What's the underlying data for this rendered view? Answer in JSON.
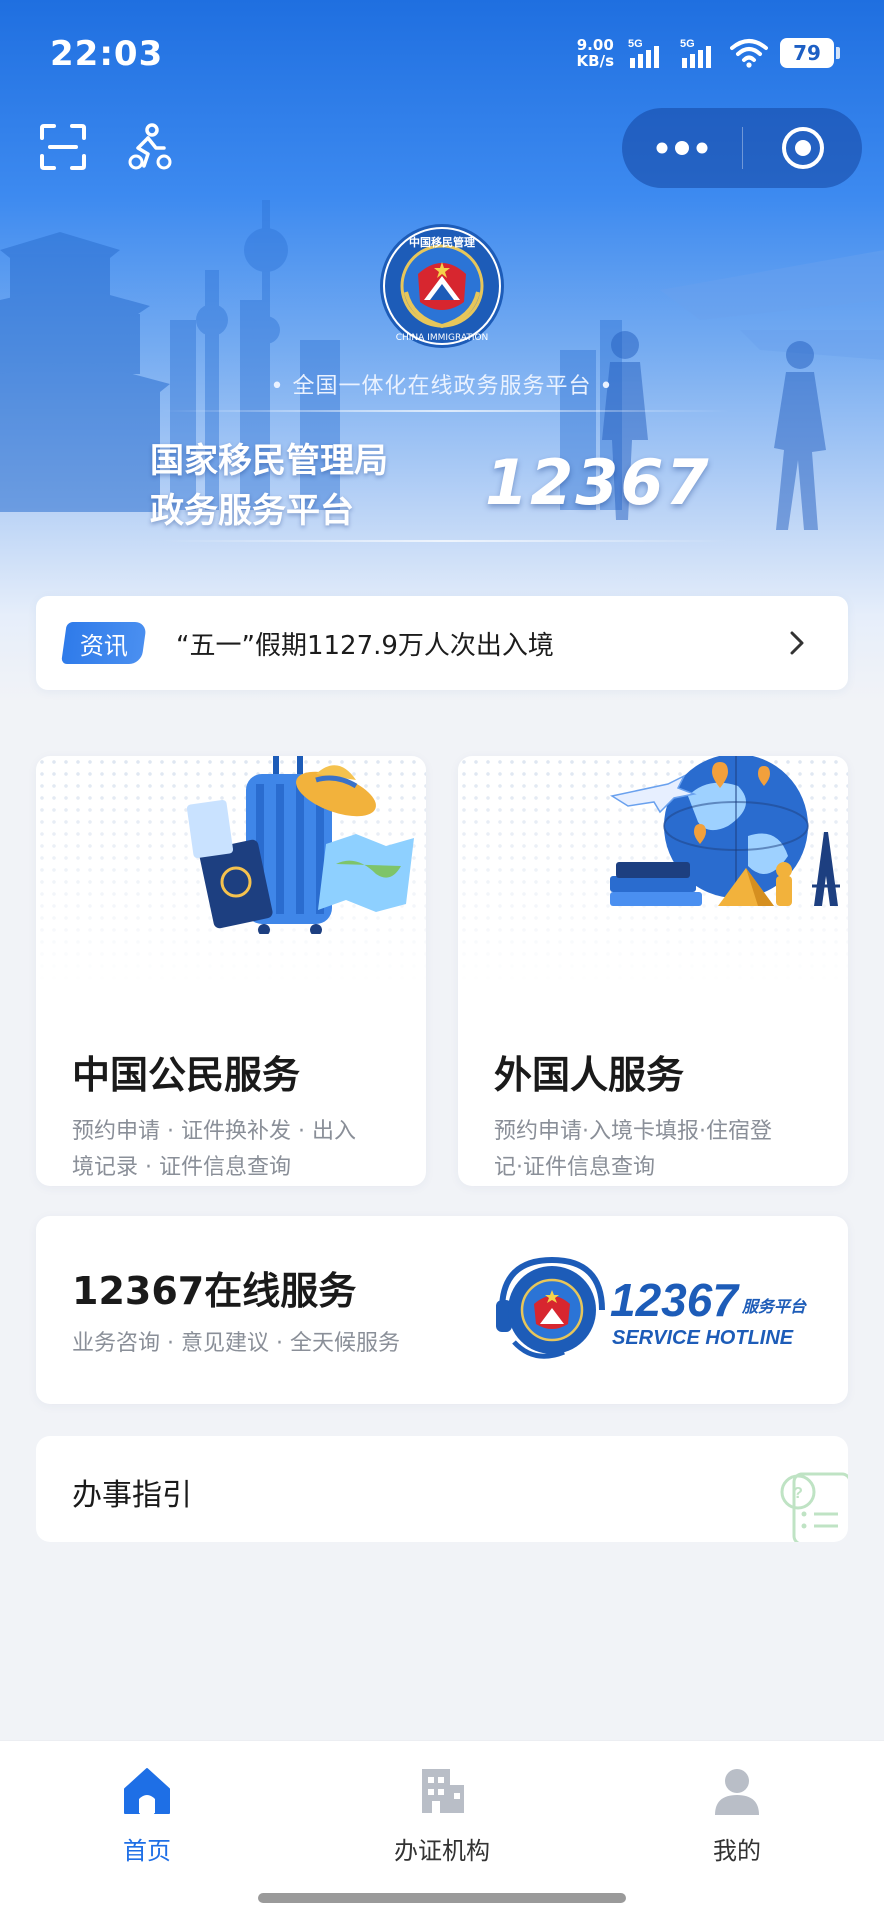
{
  "status_bar": {
    "time": "22:03",
    "net_speed_value": "9.00",
    "net_speed_unit": "KB/s",
    "signal_1": "5G",
    "signal_2": "5G",
    "battery": "79"
  },
  "toolbar": {
    "left_icons": [
      "scan-icon",
      "cycling-icon"
    ],
    "capsule_icons": [
      "more-dots-icon",
      "close-target-icon"
    ]
  },
  "hero": {
    "emblem_text": "CHINA IMMIGRATION",
    "tagline": "• 全国一体化在线政务服务平台 •",
    "title_line1": "国家移民管理局",
    "title_line2": "政务服务平台",
    "hotline": "12367"
  },
  "news": {
    "tag": "资讯",
    "headline": "“五一”假期1127.9万人次出入境"
  },
  "cards": {
    "citizen": {
      "title": "中国公民服务",
      "desc_line1": "预约申请 · 证件换补发 · 出入",
      "desc_line2": "境记录 · 证件信息查询"
    },
    "foreigner": {
      "title": "外国人服务",
      "desc_line1": "预约申请·入境卡填报·住宿登",
      "desc_line2": "记·证件信息查询"
    },
    "online": {
      "title": "12367在线服务",
      "desc": "业务咨询 · 意见建议 · 全天候服务",
      "logo_number": "12367",
      "logo_suffix": "服务平台",
      "logo_sub": "SERVICE HOTLINE"
    }
  },
  "guide": {
    "label": "办事指引"
  },
  "tabs": [
    {
      "label": "首页",
      "icon": "home-icon",
      "active": true
    },
    {
      "label": "办证机构",
      "icon": "building-icon",
      "active": false
    },
    {
      "label": "我的",
      "icon": "user-icon",
      "active": false
    }
  ],
  "colors": {
    "accent": "#1e6fe6",
    "hero_top": "#1f6fe0",
    "background": "#f1f3f7"
  }
}
